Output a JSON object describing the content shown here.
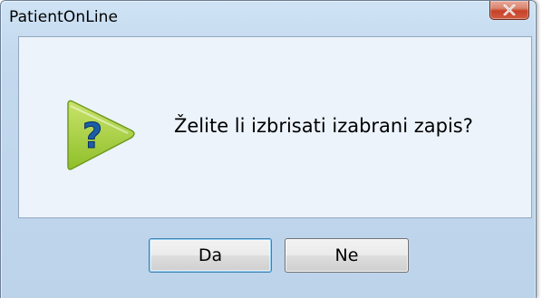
{
  "window": {
    "title": "PatientOnLine"
  },
  "dialog": {
    "message": "Želite li izbrisati izabrani zapis?",
    "icon": "question-icon"
  },
  "buttons": {
    "yes_label": "Da",
    "no_label": "Ne"
  },
  "colors": {
    "titlebar": "#c4d9ee",
    "panel": "#ecf3fb",
    "close_button": "#c7412a",
    "icon_green": "#a9cf3f",
    "icon_question": "#1a5ea8"
  }
}
